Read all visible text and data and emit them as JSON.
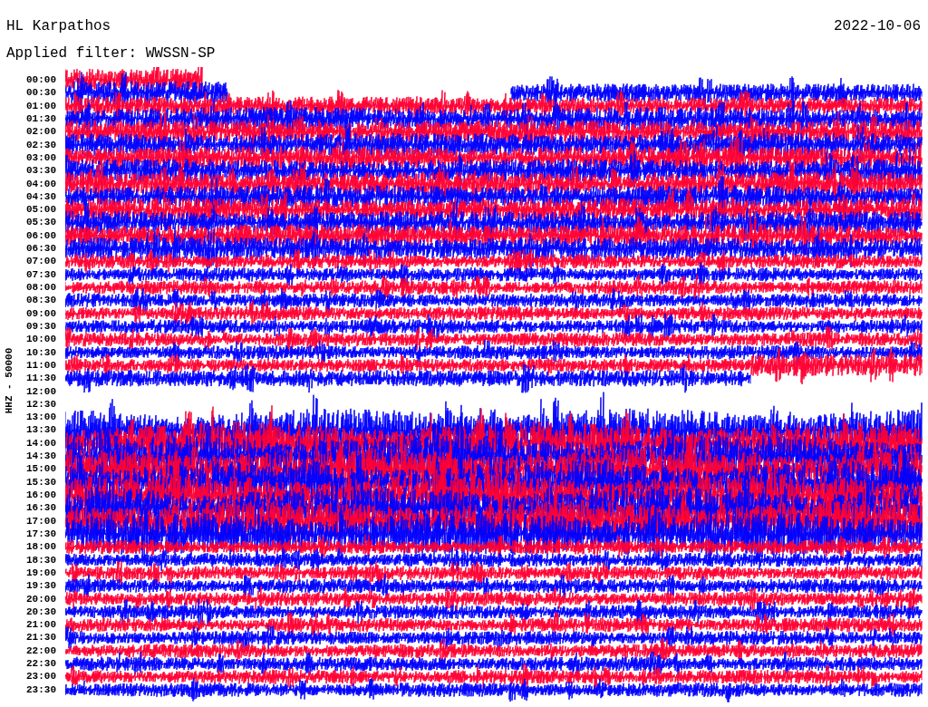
{
  "header": {
    "station": "HL Karpathos",
    "date": "2022-10-06",
    "filter": "Applied filter: WWSSN-SP"
  },
  "plot": {
    "axis_label": "HHZ - 50000",
    "rows": [
      {
        "time": "00:00",
        "color": "#ff0033"
      },
      {
        "time": "00:30",
        "color": "#0000ff"
      },
      {
        "time": "01:00",
        "color": "#ff0033"
      },
      {
        "time": "01:30",
        "color": "#0000ff"
      },
      {
        "time": "02:00",
        "color": "#ff0033"
      },
      {
        "time": "02:30",
        "color": "#0000ff"
      },
      {
        "time": "03:00",
        "color": "#ff0033"
      },
      {
        "time": "03:30",
        "color": "#0000ff"
      },
      {
        "time": "04:00",
        "color": "#ff0033"
      },
      {
        "time": "04:30",
        "color": "#0000ff"
      },
      {
        "time": "05:00",
        "color": "#ff0033"
      },
      {
        "time": "05:30",
        "color": "#0000ff"
      },
      {
        "time": "06:00",
        "color": "#ff0033"
      },
      {
        "time": "06:30",
        "color": "#0000ff"
      },
      {
        "time": "07:00",
        "color": "#ff0033"
      },
      {
        "time": "07:30",
        "color": "#0000ff"
      },
      {
        "time": "08:00",
        "color": "#ff0033"
      },
      {
        "time": "08:30",
        "color": "#0000ff"
      },
      {
        "time": "09:00",
        "color": "#ff0033"
      },
      {
        "time": "09:30",
        "color": "#0000ff"
      },
      {
        "time": "10:00",
        "color": "#ff0033"
      },
      {
        "time": "10:30",
        "color": "#0000ff"
      },
      {
        "time": "11:00",
        "color": "#ff0033"
      },
      {
        "time": "11:30",
        "color": "#0000ff"
      },
      {
        "time": "12:00"
      },
      {
        "time": "12:30"
      },
      {
        "time": "13:00"
      },
      {
        "time": "13:30",
        "color": "#0000ff"
      },
      {
        "time": "14:00",
        "color": "#ff0033"
      },
      {
        "time": "14:30",
        "color": "#0000ff"
      },
      {
        "time": "15:00",
        "color": "#ff0033"
      },
      {
        "time": "15:30",
        "color": "#0000ff"
      },
      {
        "time": "16:00",
        "color": "#ff0033"
      },
      {
        "time": "16:30",
        "color": "#0000ff"
      },
      {
        "time": "17:00",
        "color": "#ff0033"
      },
      {
        "time": "17:30",
        "color": "#0000ff"
      },
      {
        "time": "18:00",
        "color": "#ff0033"
      },
      {
        "time": "18:30",
        "color": "#0000ff"
      },
      {
        "time": "19:00",
        "color": "#ff0033"
      },
      {
        "time": "19:30",
        "color": "#0000ff"
      },
      {
        "time": "20:00",
        "color": "#ff0033"
      },
      {
        "time": "20:30",
        "color": "#0000ff"
      },
      {
        "time": "21:00",
        "color": "#ff0033"
      },
      {
        "time": "21:30",
        "color": "#0000ff"
      },
      {
        "time": "22:00",
        "color": "#ff0033"
      },
      {
        "time": "22:30",
        "color": "#0000ff"
      },
      {
        "time": "23:00",
        "color": "#ff0033"
      },
      {
        "time": "23:30",
        "color": "#0000ff"
      }
    ]
  }
}
